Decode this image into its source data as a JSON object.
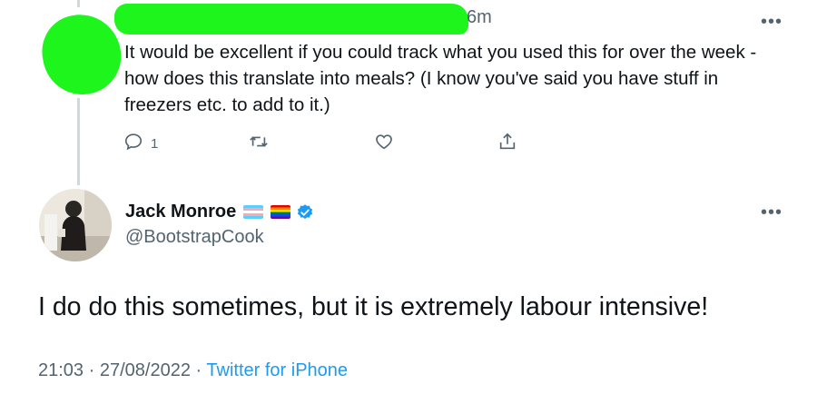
{
  "reply_tweet": {
    "time": "6m",
    "text": "It would be excellent if you could track what you used this for over the week - how does this translate into meals? (I know you've said you have stuff in freezers etc. to add to it.)",
    "reply_count": "1",
    "redaction_color": "#1df51d"
  },
  "main_tweet": {
    "author_name": "Jack Monroe",
    "flags": [
      "transgender-flag",
      "rainbow-flag"
    ],
    "handle": "@BootstrapCook",
    "text": "I do do this sometimes, but it is extremely labour intensive!",
    "time": "21:03",
    "date": "27/08/2022",
    "separator": "·",
    "source": "Twitter for iPhone"
  },
  "icons": {
    "more": "more-icon",
    "reply": "reply-icon",
    "retweet": "retweet-icon",
    "like": "like-icon",
    "share": "share-icon",
    "verified": "verified-badge-icon"
  },
  "colors": {
    "text_primary": "#0f1419",
    "text_secondary": "#536471",
    "link": "#1d9bf0",
    "verified": "#1d9bf0",
    "thread_line": "#cfd9de"
  }
}
